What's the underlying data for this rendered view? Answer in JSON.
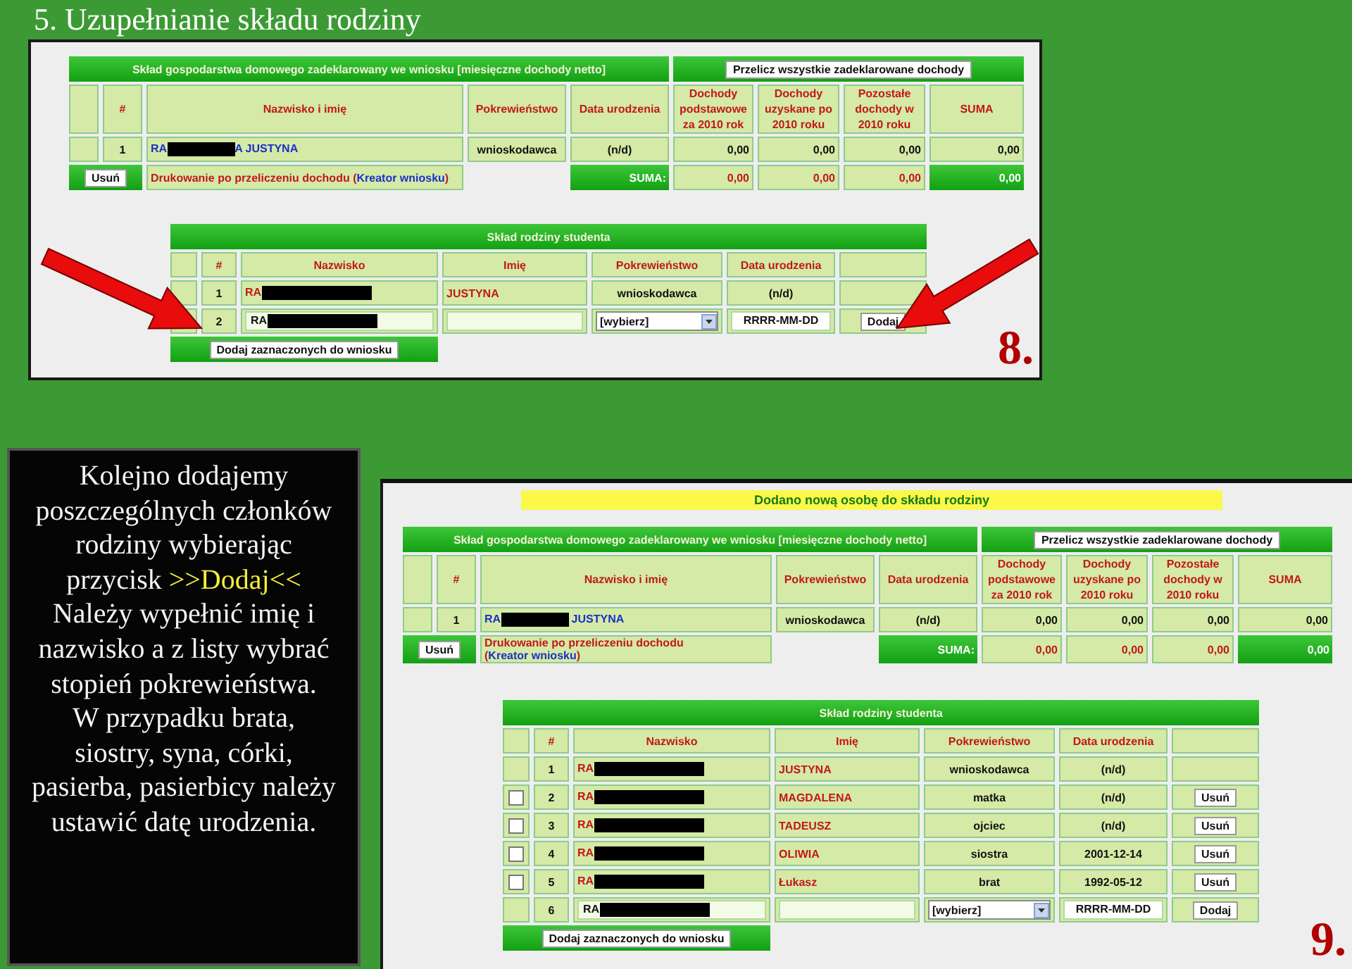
{
  "title": "5. Uzupełnianie składu rodziny",
  "instruction": {
    "paragraphs": [
      {
        "before": "Kolejno dodajemy poszczególnych członków rodziny wybierając przycisk ",
        "highlight": ">>Dodaj<<",
        "after": " Należy wypełnić imię i nazwisko a z listy wybrać stopień pokrewieństwa."
      },
      {
        "before": "W przypadku brata, siostry, syna, córki, pasierba, pasierbicy należy ustawić datę urodzenia."
      }
    ]
  },
  "panels": [
    {
      "callout_arrows": true,
      "step_label": "8.",
      "household": {
        "heading": "Skład gospodarstwa domowego zadeklarowany we wniosku [miesięczne dochody netto]",
        "recalc_button": "Przelicz wszystkie zadeklarowane dochody",
        "columns": [
          "#",
          "Nazwisko i imię",
          "Pokrewieństwo",
          "Data urodzenia",
          "Dochody podstawowe za 2010 rok",
          "Dochody uzyskane po 2010 roku",
          "Pozostałe dochody w 2010 roku",
          "SUMA"
        ],
        "rows": [
          {
            "number": "1",
            "name_start": "RA",
            "redacted": true,
            "name_end": "A JUSTYNA",
            "relation": "wnioskodawca",
            "birth_date": "(n/d)",
            "incomes": [
              "0,00",
              "0,00",
              "0,00",
              "0,00"
            ]
          }
        ],
        "footer": {
          "delete_button": "Usuń",
          "print_text": "Drukowanie po przeliczeniu dochodu (",
          "print_link": "Kreator wniosku",
          "print_text_end": ")",
          "sum_label": "SUMA:",
          "sums": [
            "0,00",
            "0,00",
            "0,00",
            "0,00"
          ]
        }
      },
      "family": {
        "heading": "Skład rodziny studenta",
        "columns": [
          "#",
          "Nazwisko",
          "Imię",
          "Pokrewieństwo",
          "Data urodzenia"
        ],
        "rows": [
          {
            "kind": "member",
            "number": "1",
            "surname": "RA",
            "redacted": true,
            "first_name": "JUSTYNA",
            "relation": "wnioskodawca",
            "birth_date": "(n/d)"
          },
          {
            "kind": "entry",
            "number": "2",
            "surname": "RA",
            "redacted": true,
            "relation_select": "[wybierz]",
            "birth_date": "RRRR-MM-DD",
            "add_button": "Dodaj"
          }
        ],
        "add_selected_button": "Dodaj zaznaczonych do wniosku"
      }
    },
    {
      "notice": "Dodano nową osobę do składu rodziny",
      "step_label": "9.",
      "household": {
        "heading": "Skład gospodarstwa domowego zadeklarowany we wniosku [miesięczne dochody netto]",
        "recalc_button": "Przelicz wszystkie zadeklarowane dochody",
        "columns": [
          "#",
          "Nazwisko i imię",
          "Pokrewieństwo",
          "Data urodzenia",
          "Dochody podstawowe za 2010 rok",
          "Dochody uzyskane po 2010 roku",
          "Pozostałe dochody w 2010 roku",
          "SUMA"
        ],
        "rows": [
          {
            "number": "1",
            "name_start": "RA",
            "redacted": true,
            "name_end": " JUSTYNA",
            "relation": "wnioskodawca",
            "birth_date": "(n/d)",
            "incomes": [
              "0,00",
              "0,00",
              "0,00",
              "0,00"
            ]
          }
        ],
        "footer": {
          "delete_button": "Usuń",
          "print_text": "Drukowanie po przeliczeniu dochodu (",
          "print_link": "Kreator wniosku",
          "print_text_end": ")",
          "sum_label": "SUMA:",
          "sums": [
            "0,00",
            "0,00",
            "0,00",
            "0,00"
          ]
        }
      },
      "family": {
        "heading": "Skład rodziny studenta",
        "columns": [
          "#",
          "Nazwisko",
          "Imię",
          "Pokrewieństwo",
          "Data urodzenia"
        ],
        "rows": [
          {
            "kind": "member",
            "number": "1",
            "surname": "RA",
            "redacted": true,
            "first_name": "JUSTYNA",
            "relation": "wnioskodawca",
            "birth_date": "(n/d)"
          },
          {
            "kind": "member",
            "number": "2",
            "checked": false,
            "surname": "RA",
            "redacted": true,
            "first_name": "MAGDALENA",
            "relation": "matka",
            "birth_date": "(n/d)",
            "delete_button": "Usuń"
          },
          {
            "kind": "member",
            "number": "3",
            "checked": false,
            "surname": "RA",
            "redacted": true,
            "first_name": "TADEUSZ",
            "relation": "ojciec",
            "birth_date": "(n/d)",
            "delete_button": "Usuń"
          },
          {
            "kind": "member",
            "number": "4",
            "checked": false,
            "surname": "RA",
            "redacted": true,
            "first_name": "OLIWIA",
            "relation": "siostra",
            "birth_date": "2001-12-14",
            "delete_button": "Usuń"
          },
          {
            "kind": "member",
            "number": "5",
            "checked": false,
            "surname": "RA",
            "redacted": true,
            "first_name": "Łukasz",
            "relation": "brat",
            "birth_date": "1992-05-12",
            "delete_button": "Usuń"
          },
          {
            "kind": "entry",
            "number": "6",
            "surname": "RA",
            "redacted": true,
            "relation_select": "[wybierz]",
            "birth_date": "RRRR-MM-DD",
            "add_button": "Dodaj"
          }
        ],
        "add_selected_button": "Dodaj zaznaczonych do wniosku"
      }
    }
  ]
}
